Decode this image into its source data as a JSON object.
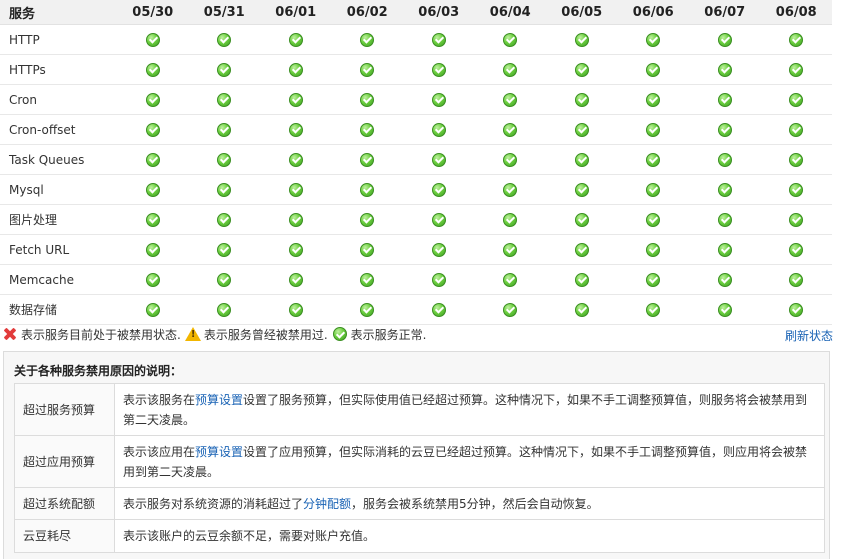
{
  "table": {
    "service_header": "服务",
    "dates": [
      "05/30",
      "05/31",
      "06/01",
      "06/02",
      "06/03",
      "06/04",
      "06/05",
      "06/06",
      "06/07",
      "06/08"
    ],
    "services": [
      "HTTP",
      "HTTPs",
      "Cron",
      "Cron-offset",
      "Task Queues",
      "Mysql",
      "图片处理",
      "Fetch URL",
      "Memcache",
      "数据存储"
    ],
    "status": "ok"
  },
  "legend": {
    "disabled_text": "表示服务目前处于被禁用状态.",
    "was_disabled_text": "表示服务曾经被禁用过.",
    "normal_text": "表示服务正常.",
    "refresh_label": "刷新状态"
  },
  "explain": {
    "title": "关于各种服务禁用原因的说明：",
    "rows": [
      {
        "name": "超过服务预算",
        "pre": "表示该服务在",
        "link": "预算设置",
        "post": "设置了服务预算，但实际使用值已经超过预算。这种情况下，如果不手工调整预算值，则服务将会被禁用到第二天凌晨。"
      },
      {
        "name": "超过应用预算",
        "pre": "表示该应用在",
        "link": "预算设置",
        "post": "设置了应用预算，但实际消耗的云豆已经超过预算。这种情况下，如果不手工调整预算值，则应用将会被禁用到第二天凌晨。"
      },
      {
        "name": "超过系统配额",
        "pre": "表示服务对系统资源的消耗超过了",
        "link": "分钟配额",
        "post": "，服务会被系统禁用5分钟，然后会自动恢复。"
      },
      {
        "name": "云豆耗尽",
        "pre": "表示该账户的云豆余额不足，需要对账户充值。",
        "link": "",
        "post": ""
      }
    ]
  }
}
